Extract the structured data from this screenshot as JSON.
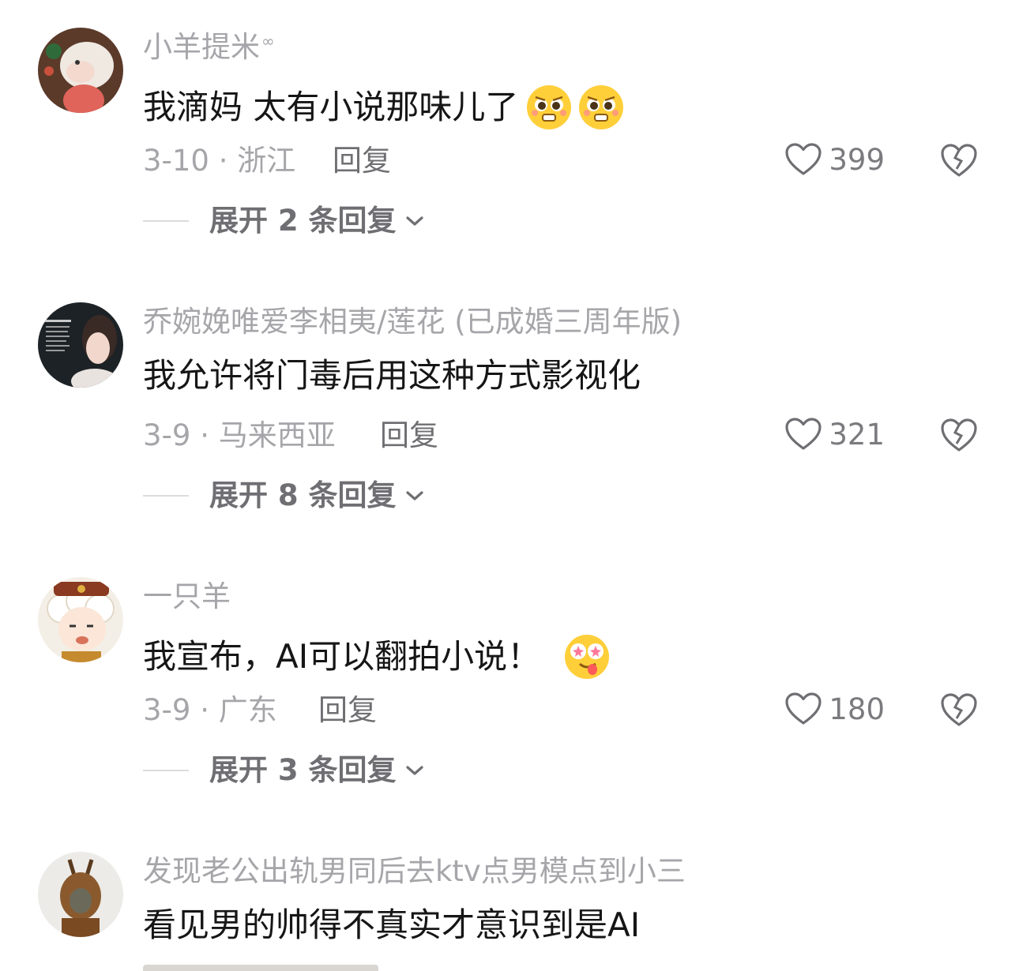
{
  "comments": [
    {
      "username": "小羊提米",
      "username_suffix": "∞",
      "text": "我滴妈 太有小说那味儿了",
      "emojis": [
        "pleading-face",
        "pleading-face"
      ],
      "date_location": "3-10 · 浙江",
      "reply_label": "回复",
      "likes": "399",
      "expand_label": "展开 2 条回复"
    },
    {
      "username": "乔婉娩唯爱李相夷/莲花 (已成婚三周年版)",
      "username_suffix": "",
      "text": "我允许将门毒后用这种方式影视化",
      "emojis": [],
      "date_location": "3-9 · 马来西亚",
      "reply_label": "回复",
      "likes": "321",
      "expand_label": "展开 8 条回复"
    },
    {
      "username": "一只羊",
      "username_suffix": "",
      "text": "我宣布，AI可以翻拍小说！",
      "emojis": [
        "star-struck-tongue-face"
      ],
      "date_location": "3-9 · 广东",
      "reply_label": "回复",
      "likes": "180",
      "expand_label": "展开 3 条回复"
    },
    {
      "username": "发现老公出轨男同后去ktv点男模点到小三",
      "username_suffix": "",
      "text": "看见男的帅得不真实才意识到是AI",
      "emojis": []
    }
  ],
  "icons": {
    "like": "heart-outline-icon",
    "dislike": "broken-heart-icon",
    "expand": "chevron-down-icon"
  },
  "colors": {
    "username": "#a6a6aa",
    "text": "#161616",
    "meta": "#a6a6aa",
    "action": "#6f6f73"
  }
}
